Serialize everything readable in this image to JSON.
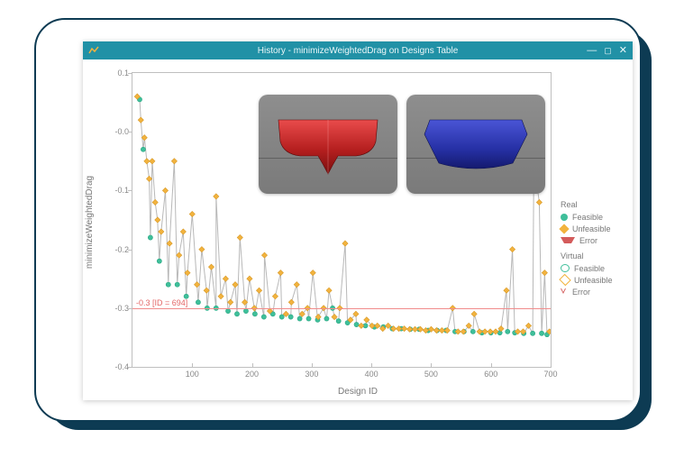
{
  "window": {
    "title": "History - minimizeWeightedDrag on Designs Table"
  },
  "chart_data": {
    "type": "scatter",
    "title": "",
    "xlabel": "Design ID",
    "ylabel": "minimizeWeightedDrag",
    "xlim": [
      0,
      700
    ],
    "ylim": [
      -0.4,
      0.1
    ],
    "xticks": [
      100,
      200,
      300,
      400,
      500,
      600,
      700
    ],
    "yticks": [
      -0.4,
      -0.3,
      -0.2,
      -0.1,
      0.0,
      0.1
    ],
    "ytick_labels": [
      "-0.4",
      "-0.3",
      "-0.2",
      "-0.1",
      "-0.0",
      "0.1"
    ],
    "reference_line": {
      "y": -0.3,
      "label": "-0.3  [ID = 694]",
      "id": 694
    },
    "legend": {
      "groups": [
        {
          "title": "Real",
          "items": [
            {
              "label": "Feasible",
              "swatch": "sw-feasible"
            },
            {
              "label": "Unfeasible",
              "swatch": "sw-unfeasible"
            },
            {
              "label": "Error",
              "swatch": "sw-error"
            }
          ]
        },
        {
          "title": "Virtual",
          "items": [
            {
              "label": "Feasible",
              "swatch": "sw-o-feasible"
            },
            {
              "label": "Unfeasible",
              "swatch": "sw-o-unfeasible"
            },
            {
              "label": "Error",
              "swatch": "sw-o-error2"
            }
          ]
        }
      ]
    },
    "series": [
      {
        "name": "Real Feasible",
        "marker": "circle",
        "color": "#3fbf9a",
        "points": [
          [
            12,
            0.055
          ],
          [
            18,
            -0.03
          ],
          [
            30,
            -0.18
          ],
          [
            45,
            -0.22
          ],
          [
            60,
            -0.26
          ],
          [
            75,
            -0.26
          ],
          [
            90,
            -0.28
          ],
          [
            110,
            -0.29
          ],
          [
            125,
            -0.3
          ],
          [
            140,
            -0.3
          ],
          [
            160,
            -0.305
          ],
          [
            175,
            -0.31
          ],
          [
            190,
            -0.305
          ],
          [
            205,
            -0.31
          ],
          [
            220,
            -0.315
          ],
          [
            235,
            -0.31
          ],
          [
            250,
            -0.315
          ],
          [
            265,
            -0.315
          ],
          [
            280,
            -0.318
          ],
          [
            295,
            -0.318
          ],
          [
            310,
            -0.32
          ],
          [
            325,
            -0.318
          ],
          [
            335,
            -0.3
          ],
          [
            345,
            -0.322
          ],
          [
            360,
            -0.325
          ],
          [
            375,
            -0.328
          ],
          [
            390,
            -0.33
          ],
          [
            405,
            -0.332
          ],
          [
            420,
            -0.332
          ],
          [
            435,
            -0.335
          ],
          [
            450,
            -0.335
          ],
          [
            465,
            -0.336
          ],
          [
            480,
            -0.336
          ],
          [
            495,
            -0.338
          ],
          [
            510,
            -0.338
          ],
          [
            525,
            -0.338
          ],
          [
            540,
            -0.34
          ],
          [
            555,
            -0.34
          ],
          [
            570,
            -0.34
          ],
          [
            585,
            -0.342
          ],
          [
            600,
            -0.342
          ],
          [
            615,
            -0.342
          ],
          [
            628,
            -0.34
          ],
          [
            640,
            -0.342
          ],
          [
            655,
            -0.343
          ],
          [
            670,
            -0.343
          ],
          [
            685,
            -0.343
          ],
          [
            694,
            -0.345
          ]
        ]
      },
      {
        "name": "Real Unfeasible",
        "marker": "diamond",
        "color": "#f2b33e",
        "points": [
          [
            8,
            0.06
          ],
          [
            14,
            0.02
          ],
          [
            20,
            -0.01
          ],
          [
            24,
            -0.05
          ],
          [
            28,
            -0.08
          ],
          [
            33,
            -0.05
          ],
          [
            38,
            -0.12
          ],
          [
            42,
            -0.15
          ],
          [
            48,
            -0.17
          ],
          [
            55,
            -0.1
          ],
          [
            62,
            -0.19
          ],
          [
            70,
            -0.05
          ],
          [
            78,
            -0.21
          ],
          [
            85,
            -0.17
          ],
          [
            92,
            -0.24
          ],
          [
            100,
            -0.14
          ],
          [
            108,
            -0.26
          ],
          [
            116,
            -0.2
          ],
          [
            124,
            -0.27
          ],
          [
            132,
            -0.23
          ],
          [
            140,
            -0.11
          ],
          [
            148,
            -0.28
          ],
          [
            156,
            -0.25
          ],
          [
            164,
            -0.29
          ],
          [
            172,
            -0.26
          ],
          [
            180,
            -0.18
          ],
          [
            188,
            -0.29
          ],
          [
            196,
            -0.25
          ],
          [
            204,
            -0.3
          ],
          [
            212,
            -0.27
          ],
          [
            221,
            -0.21
          ],
          [
            230,
            -0.305
          ],
          [
            239,
            -0.28
          ],
          [
            248,
            -0.24
          ],
          [
            257,
            -0.31
          ],
          [
            266,
            -0.29
          ],
          [
            275,
            -0.26
          ],
          [
            284,
            -0.31
          ],
          [
            293,
            -0.3
          ],
          [
            302,
            -0.24
          ],
          [
            311,
            -0.315
          ],
          [
            320,
            -0.3
          ],
          [
            329,
            -0.27
          ],
          [
            338,
            -0.315
          ],
          [
            347,
            -0.3
          ],
          [
            356,
            -0.19
          ],
          [
            365,
            -0.32
          ],
          [
            374,
            -0.31
          ],
          [
            383,
            -0.33
          ],
          [
            392,
            -0.32
          ],
          [
            401,
            -0.33
          ],
          [
            410,
            -0.33
          ],
          [
            419,
            -0.335
          ],
          [
            428,
            -0.33
          ],
          [
            437,
            -0.335
          ],
          [
            446,
            -0.335
          ],
          [
            455,
            -0.335
          ],
          [
            464,
            -0.336
          ],
          [
            473,
            -0.336
          ],
          [
            482,
            -0.336
          ],
          [
            491,
            -0.338
          ],
          [
            500,
            -0.336
          ],
          [
            509,
            -0.338
          ],
          [
            518,
            -0.338
          ],
          [
            527,
            -0.338
          ],
          [
            536,
            -0.3
          ],
          [
            545,
            -0.34
          ],
          [
            554,
            -0.34
          ],
          [
            563,
            -0.33
          ],
          [
            572,
            -0.31
          ],
          [
            581,
            -0.34
          ],
          [
            590,
            -0.34
          ],
          [
            599,
            -0.34
          ],
          [
            608,
            -0.34
          ],
          [
            617,
            -0.335
          ],
          [
            626,
            -0.27
          ],
          [
            636,
            -0.2
          ],
          [
            645,
            -0.34
          ],
          [
            654,
            -0.34
          ],
          [
            663,
            -0.33
          ],
          [
            672,
            -0.05
          ],
          [
            681,
            -0.12
          ],
          [
            690,
            -0.24
          ],
          [
            698,
            -0.34
          ]
        ]
      }
    ]
  },
  "thumbnails": [
    {
      "name": "hull-red",
      "color": "red"
    },
    {
      "name": "hull-blue",
      "color": "blue"
    }
  ]
}
